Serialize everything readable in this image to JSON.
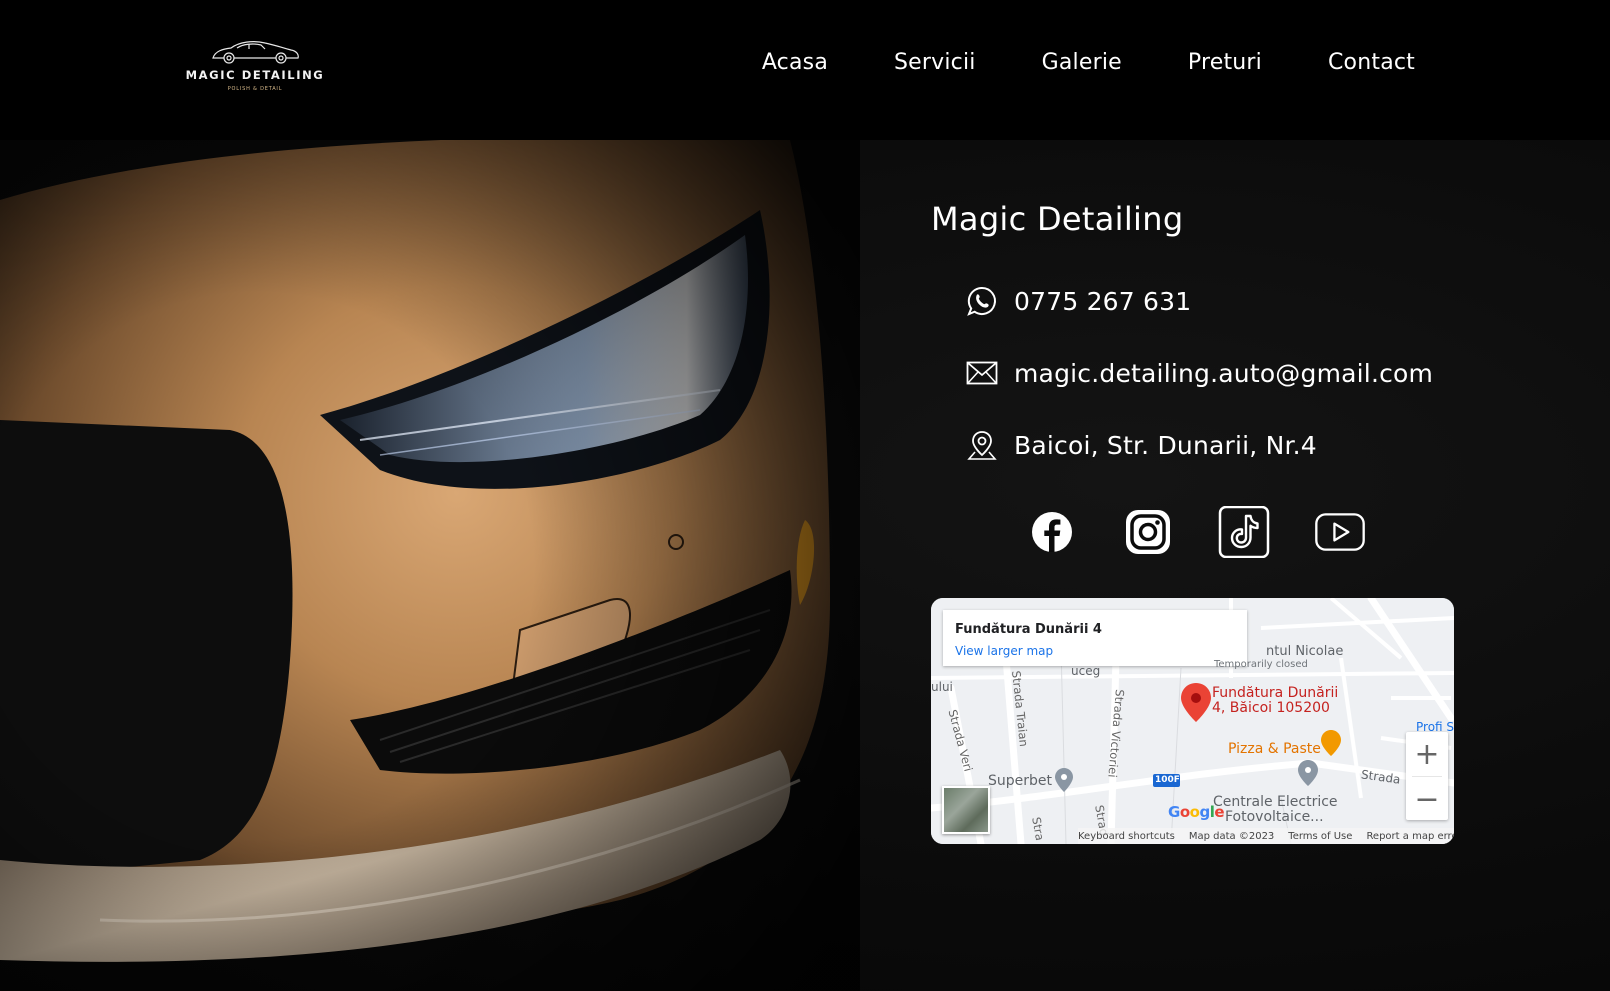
{
  "logo": {
    "title": "MAGIC DETAILING",
    "tagline": "POLISH & DETAIL"
  },
  "nav": {
    "items": [
      {
        "label": "Acasa"
      },
      {
        "label": "Servicii"
      },
      {
        "label": "Galerie"
      },
      {
        "label": "Preturi"
      },
      {
        "label": "Contact"
      }
    ]
  },
  "contact": {
    "title": "Magic Detailing",
    "phone": "0775 267 631",
    "email": "magic.detailing.auto@gmail.com",
    "address": "Baicoi, Str. Dunarii, Nr.4",
    "socials": [
      "facebook-icon",
      "instagram-icon",
      "tiktok-icon",
      "youtube-icon"
    ]
  },
  "map": {
    "card_title": "Fundătura Dunării 4",
    "card_link": "View larger map",
    "place_line1": "Fundătura Dunării",
    "place_line2": "4, Băicoi 105200",
    "poi_pizza": "Pizza & Paste",
    "poi_superbet": "Superbet",
    "poi_centrale_1": "Centrale Electrice",
    "poi_centrale_2": "Fotovoltaice...",
    "label_nicolae": "ntul Nicolae",
    "label_temp": "Temporarily closed",
    "label_uceg": "uceg",
    "label_ului": "ului",
    "label_profi": "Profi S",
    "label_strada_right": "Strada",
    "street_veri": "Strada Veri",
    "street_traian": "Strada Traian",
    "street_victoriei": "Strada Victoriei",
    "street_stra1": "Stra",
    "street_stra2": "Strad",
    "road_badge": "100F",
    "zoom_in": "+",
    "zoom_out": "−",
    "google": "Google",
    "attrib_shortcuts": "Keyboard shortcuts",
    "attrib_data": "Map data ©2023",
    "attrib_terms": "Terms of Use",
    "attrib_report": "Report a map error",
    "colors": {
      "pin": "#ea4335",
      "place_text": "#c5221f",
      "poi_orange": "#e37400",
      "link": "#1a73e8"
    }
  }
}
